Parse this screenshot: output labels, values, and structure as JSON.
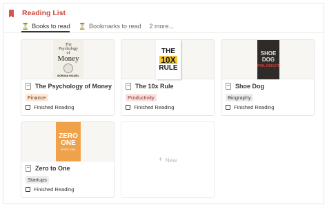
{
  "header": {
    "title": "Reading List",
    "icon": "bookmark-icon",
    "accent": "#c9463c"
  },
  "tabs": [
    {
      "label": "Books to read",
      "icon": "hourglass-icon",
      "active": true
    },
    {
      "label": "Bookmarks to read",
      "icon": "hourglass-icon",
      "active": false
    },
    {
      "label": "2 more..."
    }
  ],
  "cards": [
    {
      "title": "The Psychology of Money",
      "tag": "Finance",
      "tag_bg": "#fbe8d9",
      "status": "Finished Reading",
      "cover": {
        "line1": "The",
        "line2": "Psychology",
        "line3": "of",
        "line4": "Money",
        "author": "MORGAN HOUSEL"
      }
    },
    {
      "title": "The 10x Rule",
      "tag": "Productivity",
      "tag_bg": "#f9e1df",
      "status": "Finished Reading",
      "cover": {
        "line1": "THE",
        "line2": "10X",
        "line3": "RULE"
      }
    },
    {
      "title": "Shoe Dog",
      "tag": "Biography",
      "tag_bg": "#ebeced",
      "status": "Finished Reading",
      "cover": {
        "line1": "SHOE",
        "line2": "DOG",
        "author": "PHIL KNIGHT"
      }
    },
    {
      "title": "Zero to One",
      "tag": "Startups",
      "tag_bg": "#ebeced",
      "status": "Finished Reading",
      "cover": {
        "line1": "ZERO",
        "line2": "ONE",
        "author": "PETER THIEL"
      }
    }
  ],
  "new_card": {
    "label": "New"
  }
}
